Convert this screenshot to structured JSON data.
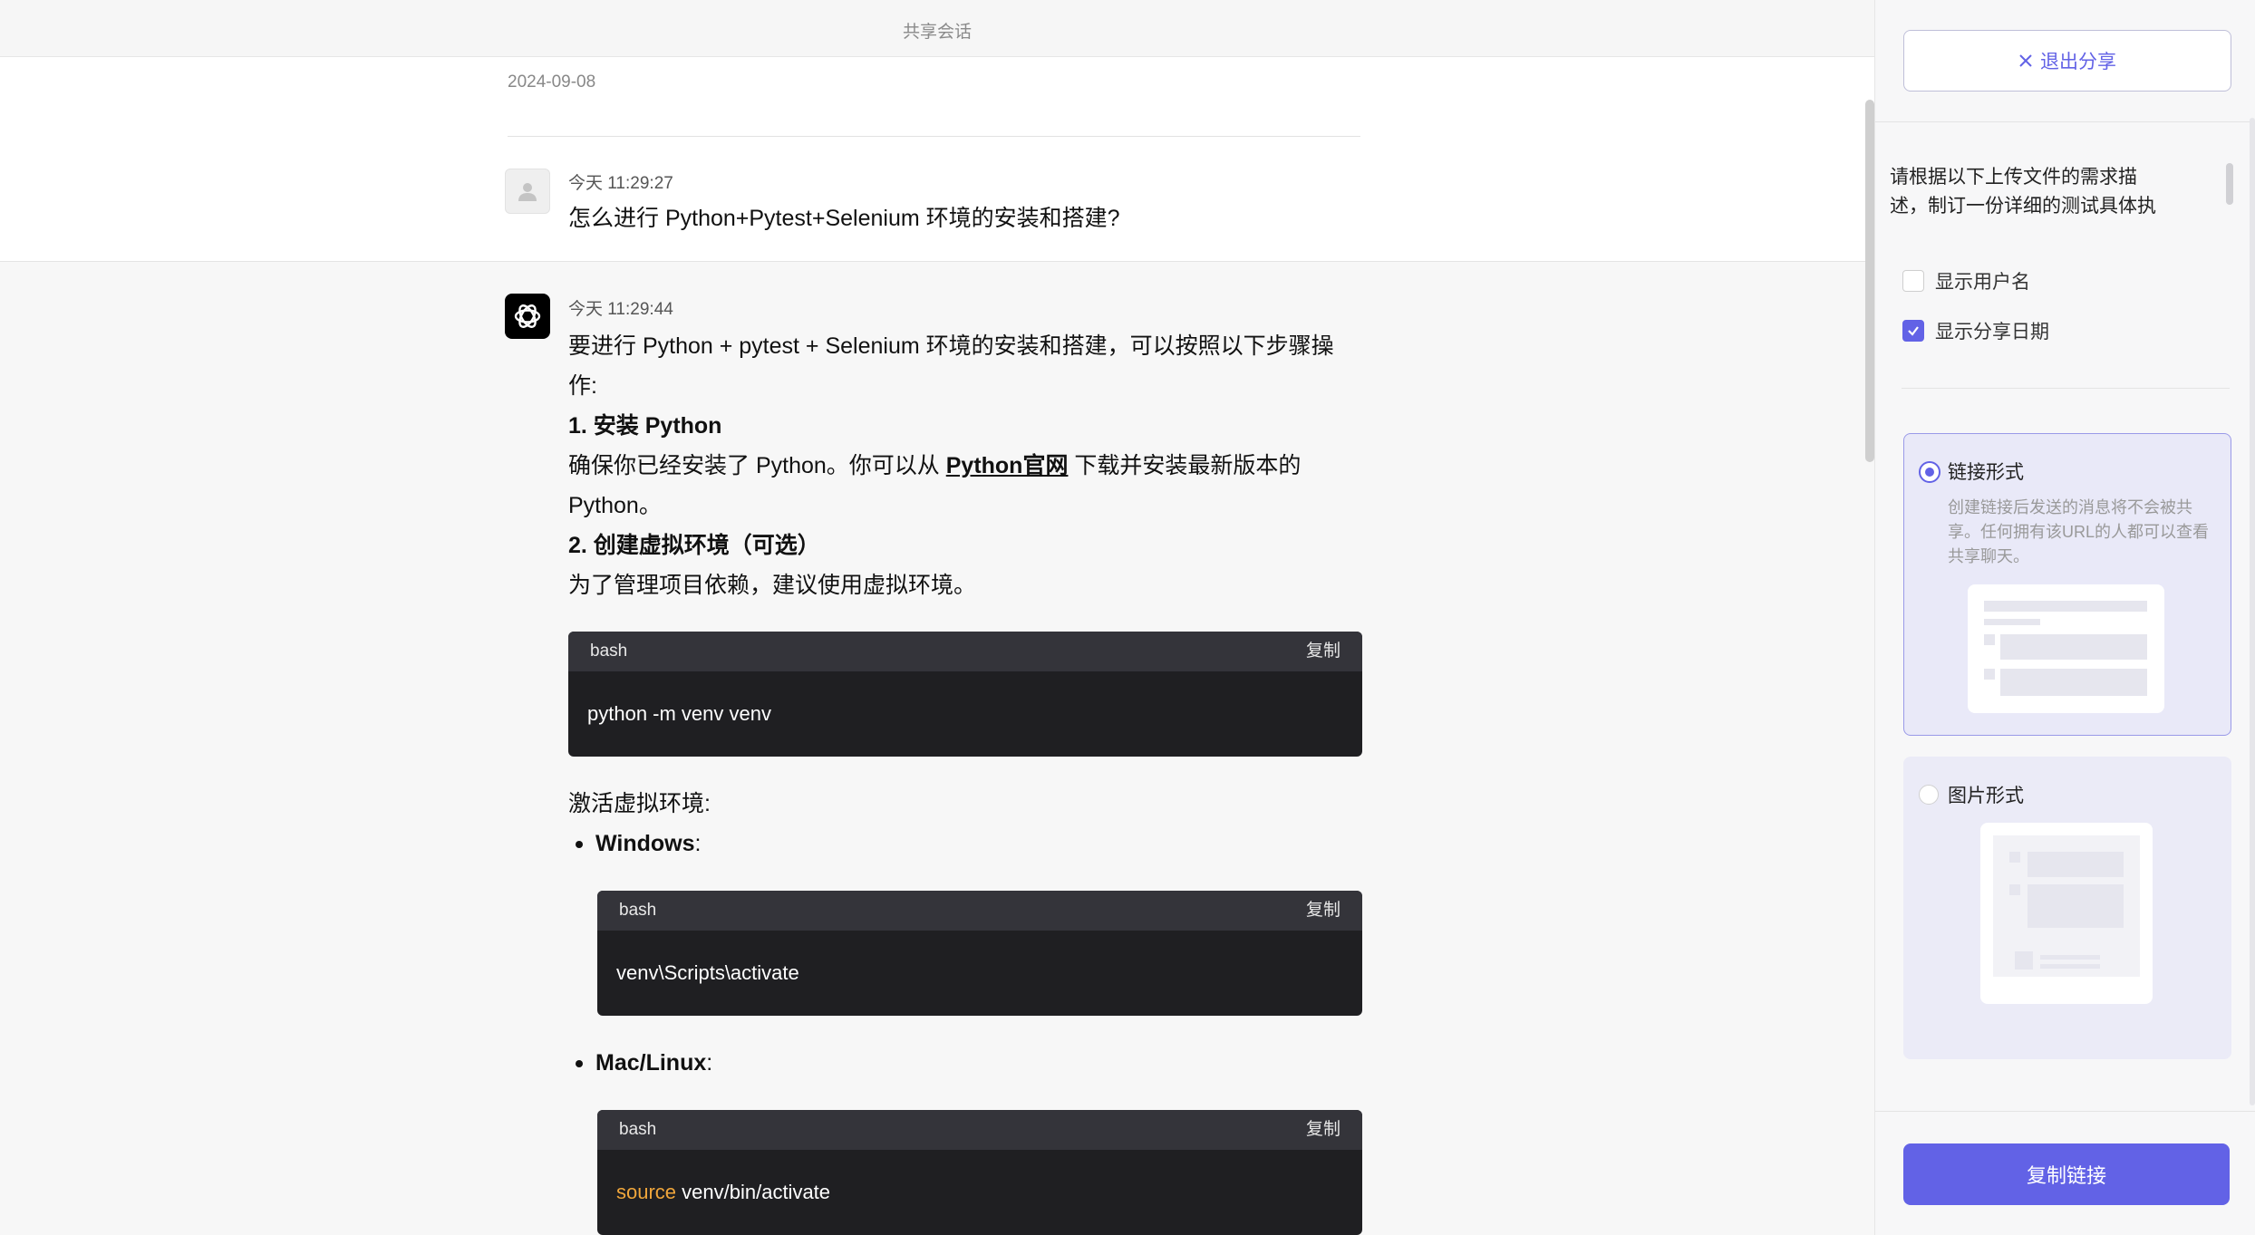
{
  "header": {
    "title": "共享会话"
  },
  "conversation": {
    "date": "2024-09-08",
    "user_message": {
      "time": "今天 11:29:27",
      "text": "怎么进行 Python+Pytest+Selenium 环境的安装和搭建?"
    },
    "ai_message": {
      "time": "今天 11:29:44",
      "intro": "要进行 Python + pytest + Selenium 环境的安装和搭建，可以按照以下步骤操作:",
      "step1_title": "1. 安装 Python",
      "step1_text_a": "确保你已经安装了 Python。你可以从 ",
      "step1_link": "Python官网",
      "step1_text_b": " 下载并安装最新版本的 Python。",
      "step2_title": "2. 创建虚拟环境（可选）",
      "step2_text": "为了管理项目依赖，建议使用虚拟环境。",
      "activate_label": "激活虚拟环境:",
      "windows_label": "Windows",
      "mac_label": "Mac/Linux",
      "colon": ":",
      "code_blocks": [
        {
          "lang": "bash",
          "copy": "复制",
          "code": "python -m venv venv"
        },
        {
          "lang": "bash",
          "copy": "复制",
          "code": "venv\\Scripts\\activate"
        },
        {
          "lang": "bash",
          "copy": "复制",
          "code_keyword": "source",
          "code_rest": " venv/bin/activate"
        }
      ]
    }
  },
  "share_panel": {
    "exit_label": "退出分享",
    "preview_text": "请根据以下上传文件的需求描述，制订一份详细的测试具体执",
    "options": [
      {
        "label": "显示用户名",
        "checked": false
      },
      {
        "label": "显示分享日期",
        "checked": true
      }
    ],
    "modes": [
      {
        "title": "链接形式",
        "selected": true,
        "desc": "创建链接后发送的消息将不会被共享。任何拥有该URL的人都可以查看共享聊天。"
      },
      {
        "title": "图片形式",
        "selected": false
      }
    ],
    "copy_link_label": "复制链接"
  },
  "colors": {
    "accent": "#6262e6",
    "code_bg": "#1f1f22",
    "code_head": "#34343a",
    "keyword": "#f0a63b"
  }
}
